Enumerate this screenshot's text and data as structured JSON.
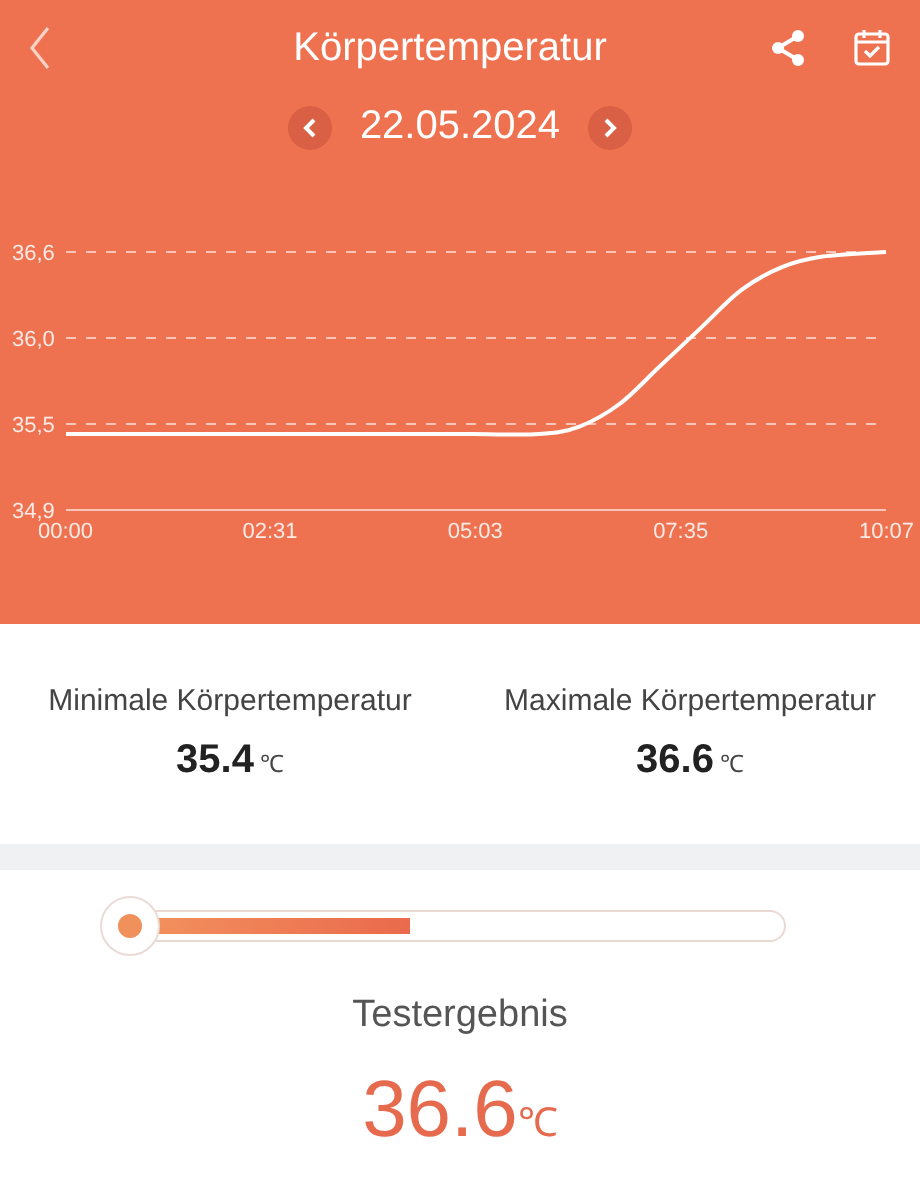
{
  "header": {
    "title": "Körpertemperatur",
    "date": "22.05.2024"
  },
  "chart_data": {
    "type": "line",
    "x": [
      0,
      60,
      120,
      180,
      240,
      300,
      350,
      380,
      410,
      440,
      470,
      500,
      530,
      560,
      607
    ],
    "ylim": [
      34.9,
      36.6
    ],
    "grid": true,
    "series": [
      {
        "color": "#ffffff",
        "values": [
          35.4,
          35.4,
          35.4,
          35.4,
          35.4,
          35.4,
          35.4,
          35.45,
          35.6,
          35.85,
          36.1,
          36.35,
          36.5,
          36.57,
          36.6
        ]
      }
    ],
    "xlim": [
      0,
      607
    ],
    "xticks": [
      {
        "value": 0,
        "label": "00:00"
      },
      {
        "value": 151,
        "label": "02:31"
      },
      {
        "value": 303,
        "label": "05:03"
      },
      {
        "value": 455,
        "label": "07:35"
      },
      {
        "value": 607,
        "label": "10:07"
      }
    ],
    "yticks": [
      {
        "value": 34.9,
        "label": "34,9"
      },
      {
        "value": 35.467,
        "label": "35,5"
      },
      {
        "value": 36.033,
        "label": "36,0"
      },
      {
        "value": 36.6,
        "label": "36,6"
      }
    ]
  },
  "stats": [
    {
      "label": "Minimale Körpertemperatur",
      "value": "35.4",
      "unit": "℃"
    },
    {
      "label": "Maximale Körpertemperatur",
      "value": "36.6",
      "unit": "℃"
    }
  ],
  "result": {
    "level": 0.44,
    "label": "Testergebnis",
    "value": "36.6",
    "unit": "℃"
  }
}
